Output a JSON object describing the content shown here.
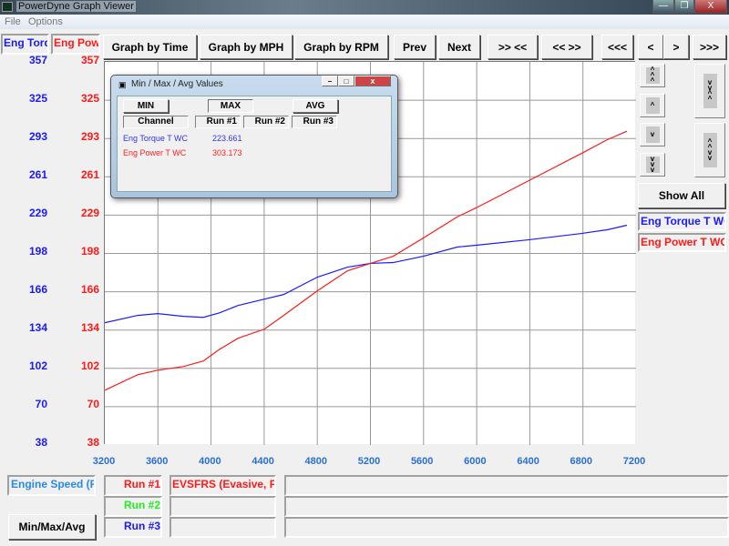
{
  "window": {
    "title": "PowerDyne Graph Viewer",
    "min": "—",
    "max": "❐",
    "close": "X"
  },
  "menu": [
    "File",
    "Options"
  ],
  "left_axes": {
    "torque_label": "Eng Torq",
    "power_label": "Eng Powe",
    "ticks": [
      "357",
      "325",
      "293",
      "261",
      "229",
      "198",
      "166",
      "134",
      "102",
      "70",
      "38"
    ]
  },
  "toolbar": [
    "Graph by Time",
    "Graph by MPH",
    "Graph by RPM",
    "Prev",
    "Next",
    ">> <<",
    "<< >>",
    "<<<",
    "<",
    ">",
    ">>>"
  ],
  "right_panel": {
    "show_all": "Show All",
    "legend": [
      "Eng Torque T WC",
      "Eng Power T WC"
    ]
  },
  "dialog": {
    "title": "Min / Max / Avg Values",
    "tabs": [
      "MIN",
      "MAX",
      "AVG"
    ],
    "headers": [
      "Channel",
      "Run #1",
      "Run #2",
      "Run #3"
    ],
    "rows": [
      {
        "channel": "Eng Torque T WC",
        "run1": "223.661"
      },
      {
        "channel": "Eng Power T WC",
        "run1": "303.173"
      }
    ]
  },
  "bottom": {
    "x_channel": "Engine Speed (RI",
    "minmax_button": "Min/Max/Avg",
    "runs": [
      "Run #1",
      "Run #2",
      "Run #3"
    ],
    "run1_name": "EVSFRS (Evasive, FR"
  },
  "colors": {
    "torque": "#1a1aff",
    "power": "#ff1a1a",
    "run2": "#22ee22"
  },
  "chart_data": {
    "type": "line",
    "xlabel": "Engine Speed (RPM)",
    "xlim": [
      3200,
      7200
    ],
    "ylim": [
      38,
      357
    ],
    "xticks": [
      "3200",
      "3600",
      "4000",
      "4400",
      "4800",
      "5200",
      "5600",
      "6000",
      "6400",
      "6800",
      "7200"
    ],
    "series": [
      {
        "name": "Eng Torque T WC",
        "color": "#1a1aff",
        "x": [
          3200,
          3447,
          3599,
          3791,
          3942,
          4066,
          4203,
          4403,
          4547,
          4801,
          5028,
          5200,
          5372,
          5599,
          5853,
          5997,
          6396,
          6795,
          6987,
          7131
        ],
        "y": [
          139.8,
          145.9,
          147.4,
          145.1,
          144.3,
          148.1,
          154.2,
          159.5,
          163.3,
          177.8,
          186.1,
          189.2,
          189.9,
          195.2,
          202.8,
          204.3,
          208.9,
          214.2,
          217.3,
          221
        ]
      },
      {
        "name": "Eng Power T WC",
        "color": "#ff1a1a",
        "x": [
          3200,
          3447,
          3599,
          3791,
          3942,
          4066,
          4203,
          4403,
          4547,
          4801,
          5028,
          5200,
          5372,
          5599,
          5853,
          5997,
          6396,
          6795,
          6987,
          7131
        ],
        "y": [
          83.6,
          96.5,
          100.3,
          103.3,
          107.9,
          117.8,
          126.9,
          134.5,
          145.9,
          166.4,
          183.1,
          189.2,
          195.2,
          210.4,
          227.9,
          235.5,
          258.3,
          281.1,
          292.4,
          299.3
        ]
      }
    ]
  }
}
